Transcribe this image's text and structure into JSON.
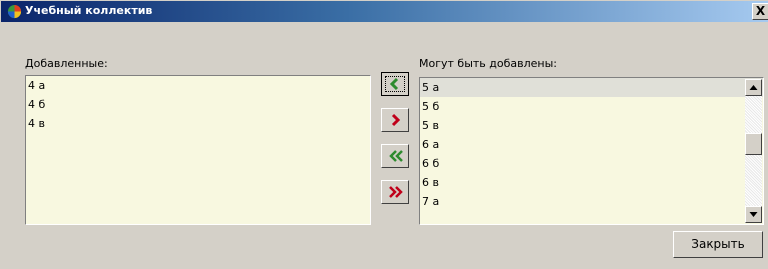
{
  "window": {
    "title": "Учебный коллектив",
    "close_glyph": "X"
  },
  "added": {
    "label": "Добавленные:",
    "items": [
      "4 а",
      "4 б",
      "4 в"
    ]
  },
  "available": {
    "label": "Могут быть добавлены:",
    "items": [
      "5 а",
      "5 б",
      "5 в",
      "6 а",
      "6 б",
      "6 в",
      "7 а"
    ],
    "selected_index": 0
  },
  "buttons": {
    "move_left_icon": "chevron-left-green-icon",
    "move_right_icon": "chevron-right-red-icon",
    "move_all_left_icon": "double-chevron-left-green-icon",
    "move_all_right_icon": "double-chevron-right-red-icon",
    "close_label": "Закрыть"
  },
  "colors": {
    "list_bg": "#f8f8e0",
    "green_arrow": "#2e8b2e",
    "red_arrow": "#c0001a"
  }
}
